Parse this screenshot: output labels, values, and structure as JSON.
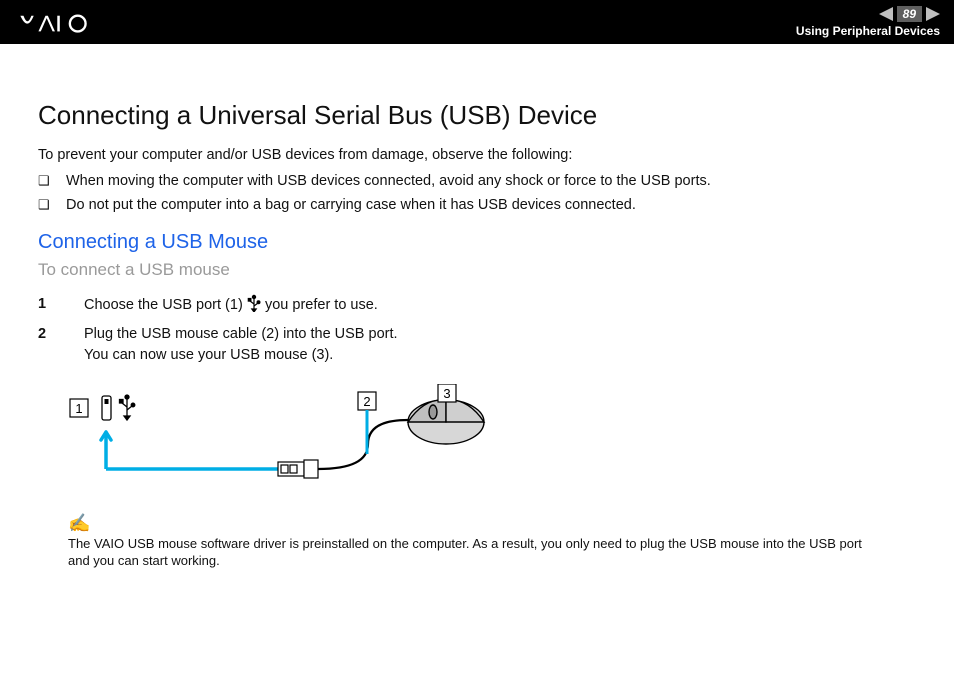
{
  "header": {
    "section_title": "Using Peripheral Devices",
    "page_number": "89"
  },
  "main_heading": "Connecting a Universal Serial Bus (USB) Device",
  "intro": "To prevent your computer and/or USB devices from damage, observe the following:",
  "cautions": [
    "When moving the computer with USB devices connected, avoid any shock or force to the USB ports.",
    "Do not put the computer into a bag or carrying case when it has USB devices connected."
  ],
  "sub_heading": "Connecting a USB Mouse",
  "task_heading": "To connect a USB mouse",
  "steps": [
    {
      "n": "1",
      "text_before": "Choose the USB port (1) ",
      "text_after": " you prefer to use."
    },
    {
      "n": "2",
      "text_before": "Plug the USB mouse cable (2) into the USB port.",
      "text_after": "You can now use your USB mouse (3)."
    }
  ],
  "diagram": {
    "callouts": {
      "one": "1",
      "two": "2",
      "three": "3"
    }
  },
  "note_text": "The VAIO USB mouse software driver is preinstalled on the computer. As a result, you only need to plug the USB mouse into the USB port and you can start working."
}
